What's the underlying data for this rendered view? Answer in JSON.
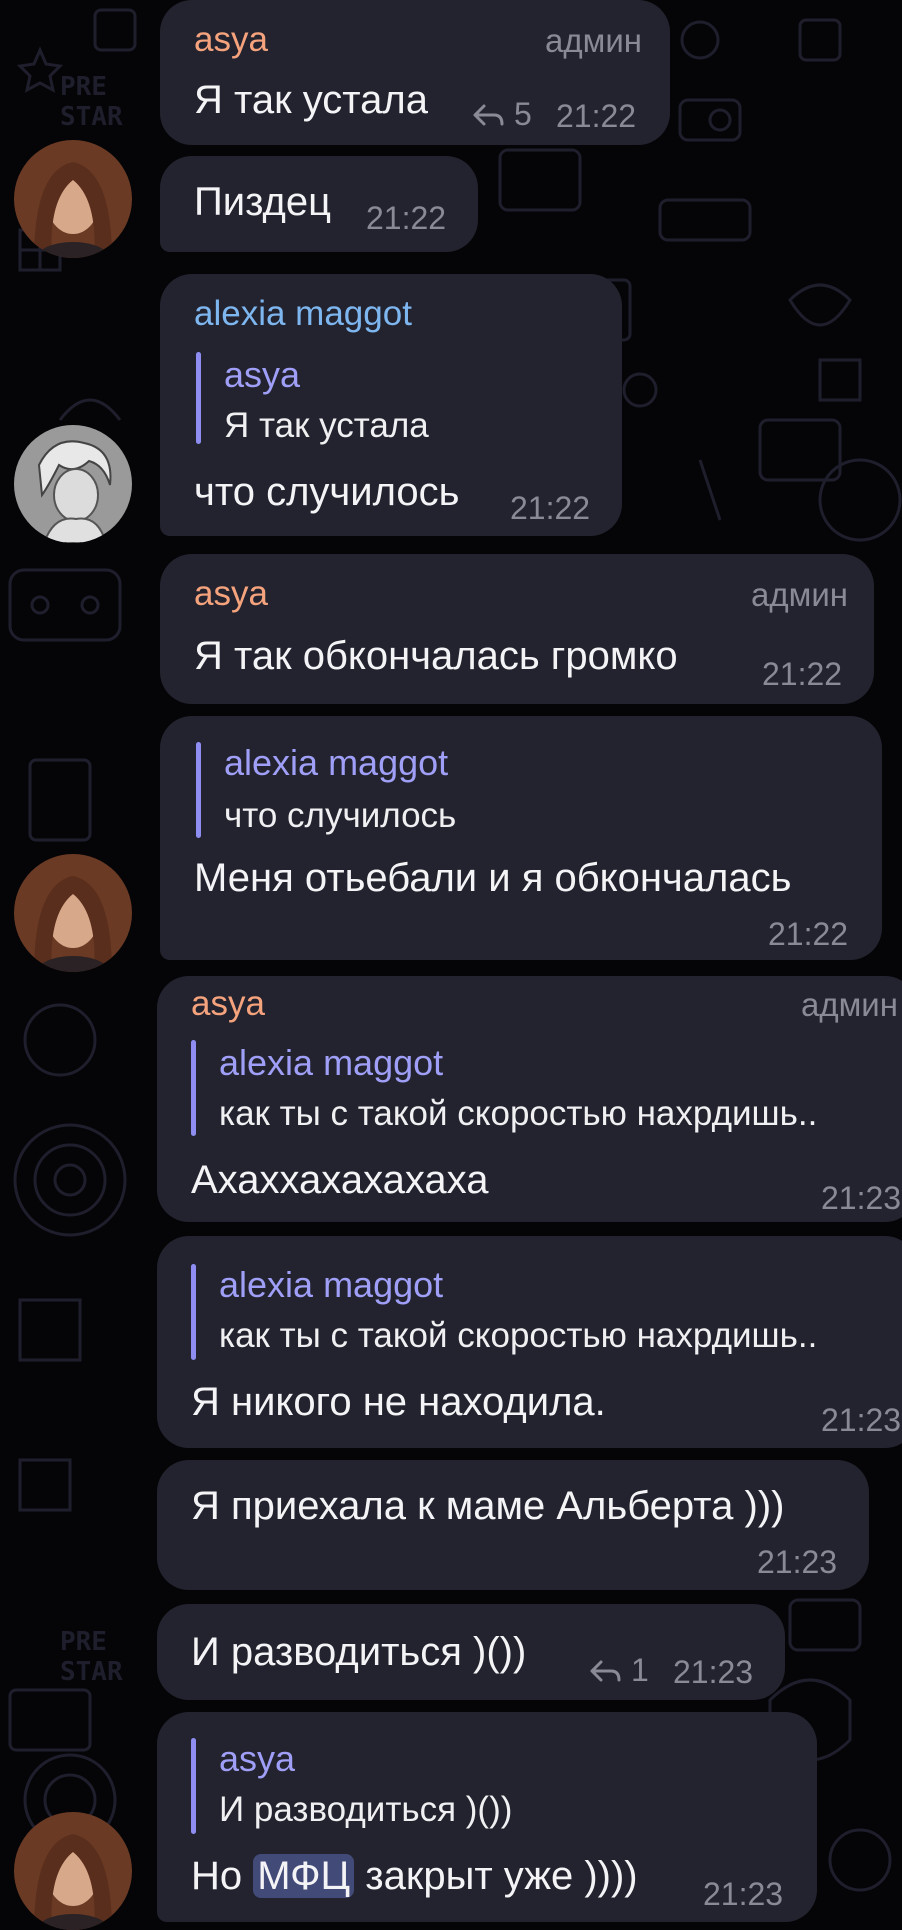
{
  "colors": {
    "background": "#050508",
    "bubble": "#23232f",
    "asya_name": "#f5a37d",
    "alexia_name": "#7eb6f0",
    "reply_accent": "#8e8ef2",
    "meta": "#8a8a97",
    "highlight": "#424a78"
  },
  "messages": [
    {
      "sender": "asya",
      "admin": "админ",
      "text": "Я так устала",
      "replies": "5",
      "time": "21:22"
    },
    {
      "text": "Пиздец",
      "time": "21:22"
    },
    {
      "sender": "alexia maggot",
      "reply_name": "asya",
      "reply_text": "Я так устала",
      "text": "что случилось",
      "time": "21:22"
    },
    {
      "sender": "asya",
      "admin": "админ",
      "text": "Я так обкончалась громко",
      "time": "21:22"
    },
    {
      "reply_name": "alexia maggot",
      "reply_text": "что случилось",
      "text": "Меня отьебали и я обкончалась",
      "time": "21:22"
    },
    {
      "sender": "asya",
      "admin": "админ",
      "reply_name": "alexia maggot",
      "reply_text": "как ты с такой скоростью нахрдишь..",
      "text": "Ахаххахахахаха",
      "time": "21:23"
    },
    {
      "reply_name": "alexia maggot",
      "reply_text": "как ты с такой скоростью нахрдишь..",
      "text": "Я никого не находила.",
      "time": "21:23"
    },
    {
      "text": "Я приехала к маме Альберта )))",
      "time": "21:23"
    },
    {
      "text": "И разводиться )())",
      "replies": "1",
      "time": "21:23"
    },
    {
      "reply_name": "asya",
      "reply_text": "И разводиться )())",
      "text_before": "Но",
      "text_highlight": "МФЦ",
      "text_after": "закрыт уже ))))",
      "time": "21:23"
    }
  ]
}
